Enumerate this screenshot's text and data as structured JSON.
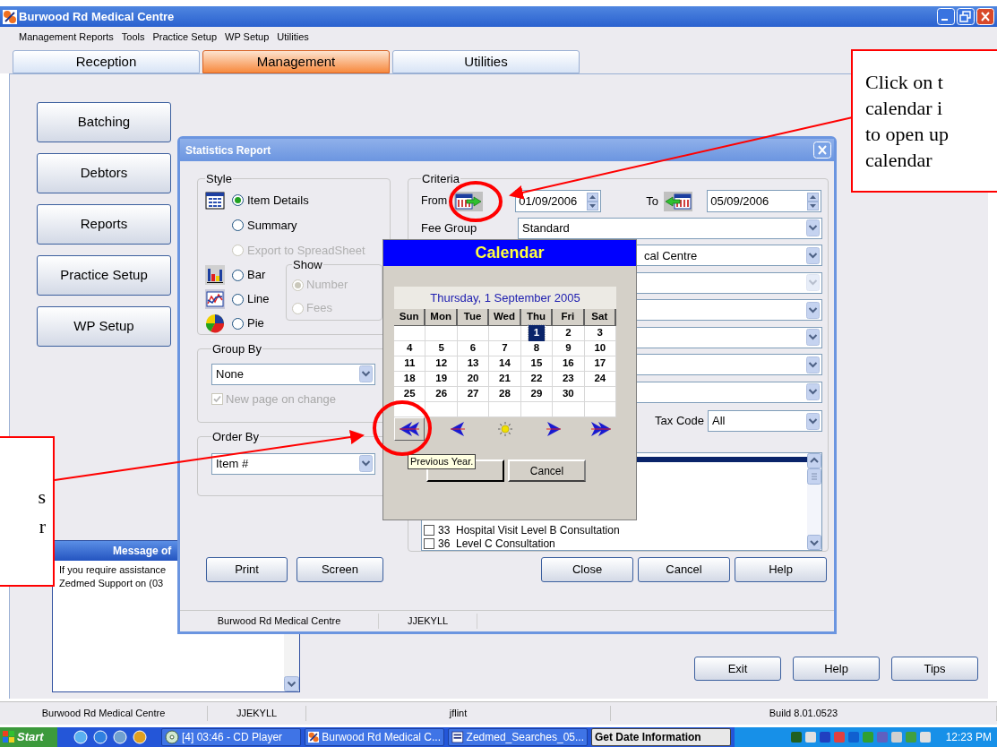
{
  "window": {
    "title": "Burwood Rd Medical Centre"
  },
  "menu": [
    "Management Reports",
    "Tools",
    "Practice Setup",
    "WP Setup",
    "Utilities"
  ],
  "tabs": [
    {
      "label": "Reception",
      "selected": false
    },
    {
      "label": "Management",
      "selected": true
    },
    {
      "label": "Utilities",
      "selected": false
    }
  ],
  "nav_buttons": [
    "Batching",
    "Debtors",
    "Reports",
    "Practice Setup",
    "WP Setup"
  ],
  "message_panel": {
    "title": "Message of",
    "lines": [
      "If you require assistance",
      "Zedmed Support on (03"
    ]
  },
  "main_buttons": [
    "Exit",
    "Help",
    "Tips"
  ],
  "status_bar": [
    "Burwood Rd Medical Centre",
    "JJEKYLL",
    "jflint",
    "Build 8.01.0523"
  ],
  "dialog": {
    "title": "Statistics Report",
    "style": {
      "title": "Style",
      "options": [
        {
          "label": "Item Details",
          "selected": true,
          "disabled": false,
          "kind": "table"
        },
        {
          "label": "Summary",
          "selected": false,
          "disabled": false
        },
        {
          "label": "Export to SpreadSheet",
          "selected": false,
          "disabled": true
        }
      ],
      "chart_options": [
        {
          "label": "Bar",
          "selected": false,
          "disabled": false,
          "kind": "bar"
        },
        {
          "label": "Line",
          "selected": false,
          "disabled": false,
          "kind": "line"
        },
        {
          "label": "Pie",
          "selected": false,
          "disabled": false,
          "kind": "pie"
        }
      ],
      "show": {
        "title": "Show",
        "options": [
          {
            "label": "Number",
            "selected": true,
            "disabled": true
          },
          {
            "label": "Fees",
            "selected": false,
            "disabled": true
          }
        ]
      }
    },
    "group_by": {
      "title": "Group By",
      "value": "None",
      "checkbox": {
        "label": "New page on change",
        "checked": true,
        "disabled": true
      }
    },
    "order_by": {
      "title": "Order By",
      "value": "Item #"
    },
    "criteria": {
      "title": "Criteria",
      "from": {
        "label": "From",
        "value": "01/09/2006"
      },
      "to": {
        "label": "To",
        "value": "05/09/2006"
      },
      "dropdowns": [
        {
          "kind": "plain",
          "label": "Fee Group",
          "value": "Standard",
          "disabled": false
        },
        {
          "kind": "covered",
          "value": "cal Centre",
          "disabled": false
        },
        {
          "kind": "plain",
          "disabled": true
        },
        {
          "kind": "plain",
          "disabled": false
        },
        {
          "kind": "plain",
          "disabled": false
        },
        {
          "kind": "plain",
          "disabled": false
        },
        {
          "kind": "plain",
          "disabled": false
        }
      ],
      "tax_code": {
        "label": "Tax Code",
        "value": "All"
      },
      "list": [
        {
          "kind": "bar",
          "selected": true
        },
        {
          "kind": "item",
          "text": "33  Hospital Visit Level B Consultation",
          "checked": false
        },
        {
          "kind": "item",
          "text": "36  Level C Consultation",
          "checked": false
        }
      ]
    },
    "left_buttons": [
      "Print",
      "Screen"
    ],
    "right_buttons": [
      "Close",
      "Cancel",
      "Help"
    ],
    "status_bar": [
      "Burwood Rd Medical Centre",
      "JJEKYLL"
    ]
  },
  "calendar": {
    "title": "Calendar",
    "heading": "Thursday, 1 September 2005",
    "weekdays": [
      "Sun",
      "Mon",
      "Tue",
      "Wed",
      "Thu",
      "Fri",
      "Sat"
    ],
    "weeks": [
      [
        {
          "kind": "blank"
        },
        {
          "kind": "blank"
        },
        {
          "kind": "blank"
        },
        {
          "kind": "blank"
        },
        {
          "kind": "day",
          "day": "1",
          "selected": true
        },
        {
          "kind": "day",
          "day": "2",
          "selected": false
        },
        {
          "kind": "day",
          "day": "3",
          "selected": false
        }
      ],
      [
        {
          "kind": "day",
          "day": "4",
          "selected": false
        },
        {
          "kind": "day",
          "day": "5",
          "selected": false
        },
        {
          "kind": "day",
          "day": "6",
          "selected": false
        },
        {
          "kind": "day",
          "day": "7",
          "selected": false
        },
        {
          "kind": "day",
          "day": "8",
          "selected": false
        },
        {
          "kind": "day",
          "day": "9",
          "selected": false
        },
        {
          "kind": "day",
          "day": "10",
          "selected": false
        }
      ],
      [
        {
          "kind": "day",
          "day": "11",
          "selected": false
        },
        {
          "kind": "day",
          "day": "12",
          "selected": false
        },
        {
          "kind": "day",
          "day": "13",
          "selected": false
        },
        {
          "kind": "day",
          "day": "14",
          "selected": false
        },
        {
          "kind": "day",
          "day": "15",
          "selected": false
        },
        {
          "kind": "day",
          "day": "16",
          "selected": false
        },
        {
          "kind": "day",
          "day": "17",
          "selected": false
        }
      ],
      [
        {
          "kind": "day",
          "day": "18",
          "selected": false
        },
        {
          "kind": "day",
          "day": "19",
          "selected": false
        },
        {
          "kind": "day",
          "day": "20",
          "selected": false
        },
        {
          "kind": "day",
          "day": "21",
          "selected": false
        },
        {
          "kind": "day",
          "day": "22",
          "selected": false
        },
        {
          "kind": "day",
          "day": "23",
          "selected": false
        },
        {
          "kind": "day",
          "day": "24",
          "selected": false
        }
      ],
      [
        {
          "kind": "day",
          "day": "25",
          "selected": false
        },
        {
          "kind": "day",
          "day": "26",
          "selected": false
        },
        {
          "kind": "day",
          "day": "27",
          "selected": false
        },
        {
          "kind": "day",
          "day": "28",
          "selected": false
        },
        {
          "kind": "day",
          "day": "29",
          "selected": false
        },
        {
          "kind": "day",
          "day": "30",
          "selected": false
        },
        {
          "kind": "blank"
        }
      ],
      [
        {
          "kind": "blank"
        },
        {
          "kind": "blank"
        },
        {
          "kind": "blank"
        },
        {
          "kind": "blank"
        },
        {
          "kind": "blank"
        },
        {
          "kind": "blank"
        },
        {
          "kind": "blank"
        }
      ]
    ],
    "nav": [
      {
        "kind": "prev_year",
        "raised": true
      },
      {
        "kind": "prev_month",
        "raised": false
      },
      {
        "kind": "today",
        "raised": false
      },
      {
        "kind": "next_month",
        "raised": false
      },
      {
        "kind": "next_year",
        "raised": false
      }
    ],
    "buttons": [
      "Cancel"
    ]
  },
  "tooltip": "Previous Year.",
  "callouts": [
    {
      "kind": "right",
      "lines": [
        "Click on t",
        "calendar i",
        "to open up",
        "calendar"
      ]
    },
    {
      "kind": "left",
      "lines": [
        "s",
        "r"
      ]
    }
  ],
  "taskbar": {
    "start": "Start",
    "tasks": [
      {
        "label": "[4] 03:46 - CD Player",
        "kind": "cd",
        "active": false
      },
      {
        "label": "Burwood Rd Medical C...",
        "kind": "app",
        "active": false
      },
      {
        "label": "Zedmed_Searches_05...",
        "kind": "word",
        "active": false
      },
      {
        "label": "Get Date Information",
        "kind": "plain",
        "active": true
      }
    ],
    "clock": "12:23 PM"
  }
}
